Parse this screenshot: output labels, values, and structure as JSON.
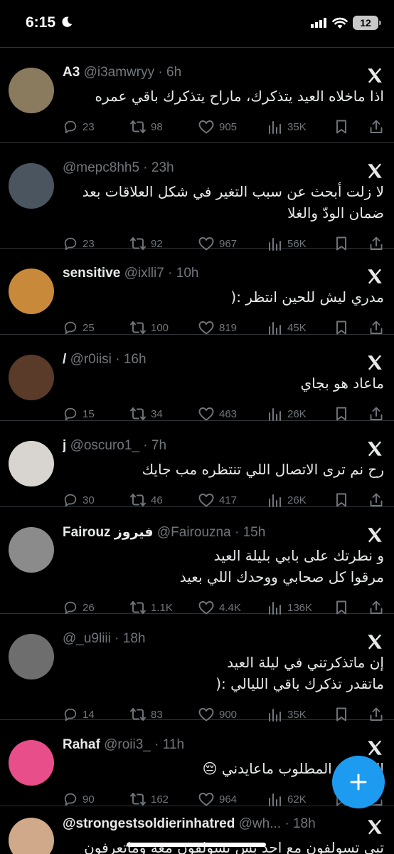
{
  "status_bar": {
    "time": "6:15",
    "battery": "12"
  },
  "tweets": [
    {
      "name": "A3",
      "handle": "@i3amwryy",
      "time": "6h",
      "text": "اذا ماخلاه العيد يتذكرك، ماراح يتذكرك باقي عمره",
      "replies": "23",
      "retweets": "98",
      "likes": "905",
      "views": "35K",
      "avatar_color": "#8a7a5e"
    },
    {
      "name": "",
      "handle": "@mepc8hh5",
      "time": "23h",
      "text": "لا زلت أبحث عن سبب التغير في شكل العلاقات بعد\nضمان الودّ والغلا",
      "replies": "23",
      "retweets": "92",
      "likes": "967",
      "views": "56K",
      "avatar_color": "#4a5560"
    },
    {
      "name": "sensitive",
      "handle": "@ixlli7",
      "time": "10h",
      "text": "مدري ليش للحين انتظر :(",
      "replies": "25",
      "retweets": "100",
      "likes": "819",
      "views": "45K",
      "avatar_color": "#c9893a"
    },
    {
      "name": "/",
      "handle": "@r0iisi",
      "time": "16h",
      "text": "ماعاد هو بجاي",
      "replies": "15",
      "retweets": "34",
      "likes": "463",
      "views": "26K",
      "avatar_color": "#5a3a28"
    },
    {
      "name": "j",
      "handle": "@oscuro1_",
      "time": "7h",
      "text": "رح نم ترى الاتصال اللي تنتظره مب جايك",
      "replies": "30",
      "retweets": "46",
      "likes": "417",
      "views": "26K",
      "avatar_color": "#d8d4d0"
    },
    {
      "name": "Fairouz فيروز",
      "handle": "@Fairouzna",
      "time": "15h",
      "text": "و نطرتك على بابي بليلة العيد\nمرقوا كل صحابي ووحدك اللي بعيد",
      "replies": "26",
      "retweets": "1.1K",
      "likes": "4.4K",
      "views": "136K",
      "avatar_color": "#8b8b8b"
    },
    {
      "name": "",
      "handle": "@_u9liii",
      "time": "18h",
      "text": "إن ماتذكرتني في ليلة العيد\nماتقدر تذكرك باقي الليالي :(",
      "replies": "14",
      "retweets": "83",
      "likes": "900",
      "views": "35K",
      "avatar_color": "#6e6e6e"
    },
    {
      "name": "Rahaf",
      "handle": "@roii3_",
      "time": "11h",
      "text": "الشخص المطلوب ماعايدني 😔",
      "replies": "90",
      "retweets": "162",
      "likes": "964",
      "views": "62K",
      "avatar_color": "#e84e8a"
    },
    {
      "name": "@strongestsoldierinhatred",
      "handle": "@wh...",
      "time": "18h",
      "text": "تبي تسولفون مع احد بس تسولفون معه وماتعرفون كيف",
      "replies": "",
      "retweets": "",
      "likes": "",
      "views": "",
      "avatar_color": "#cfa98a"
    }
  ]
}
